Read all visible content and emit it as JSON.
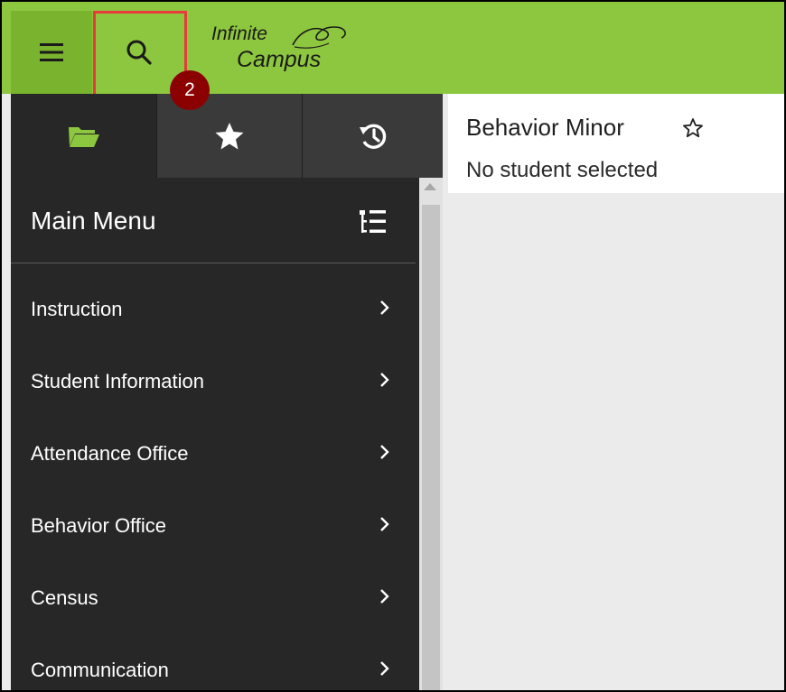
{
  "header": {
    "logo_line1": "Infinite",
    "logo_line2": "Campus",
    "step_badge": "2",
    "colors": {
      "bar": "#8dc63f",
      "menu_button": "#7ab32e",
      "highlight": "#e83a3a",
      "badge": "#8b0000"
    }
  },
  "sidebar": {
    "tabs": [
      {
        "name": "folder-icon",
        "active": true
      },
      {
        "name": "star-icon",
        "active": false
      },
      {
        "name": "history-icon",
        "active": false
      }
    ],
    "menu_title": "Main Menu",
    "items": [
      {
        "label": "Instruction"
      },
      {
        "label": "Student Information"
      },
      {
        "label": "Attendance Office"
      },
      {
        "label": "Behavior Office"
      },
      {
        "label": "Census"
      },
      {
        "label": "Communication"
      }
    ]
  },
  "content": {
    "title": "Behavior Minor",
    "subtitle": "No student selected"
  }
}
